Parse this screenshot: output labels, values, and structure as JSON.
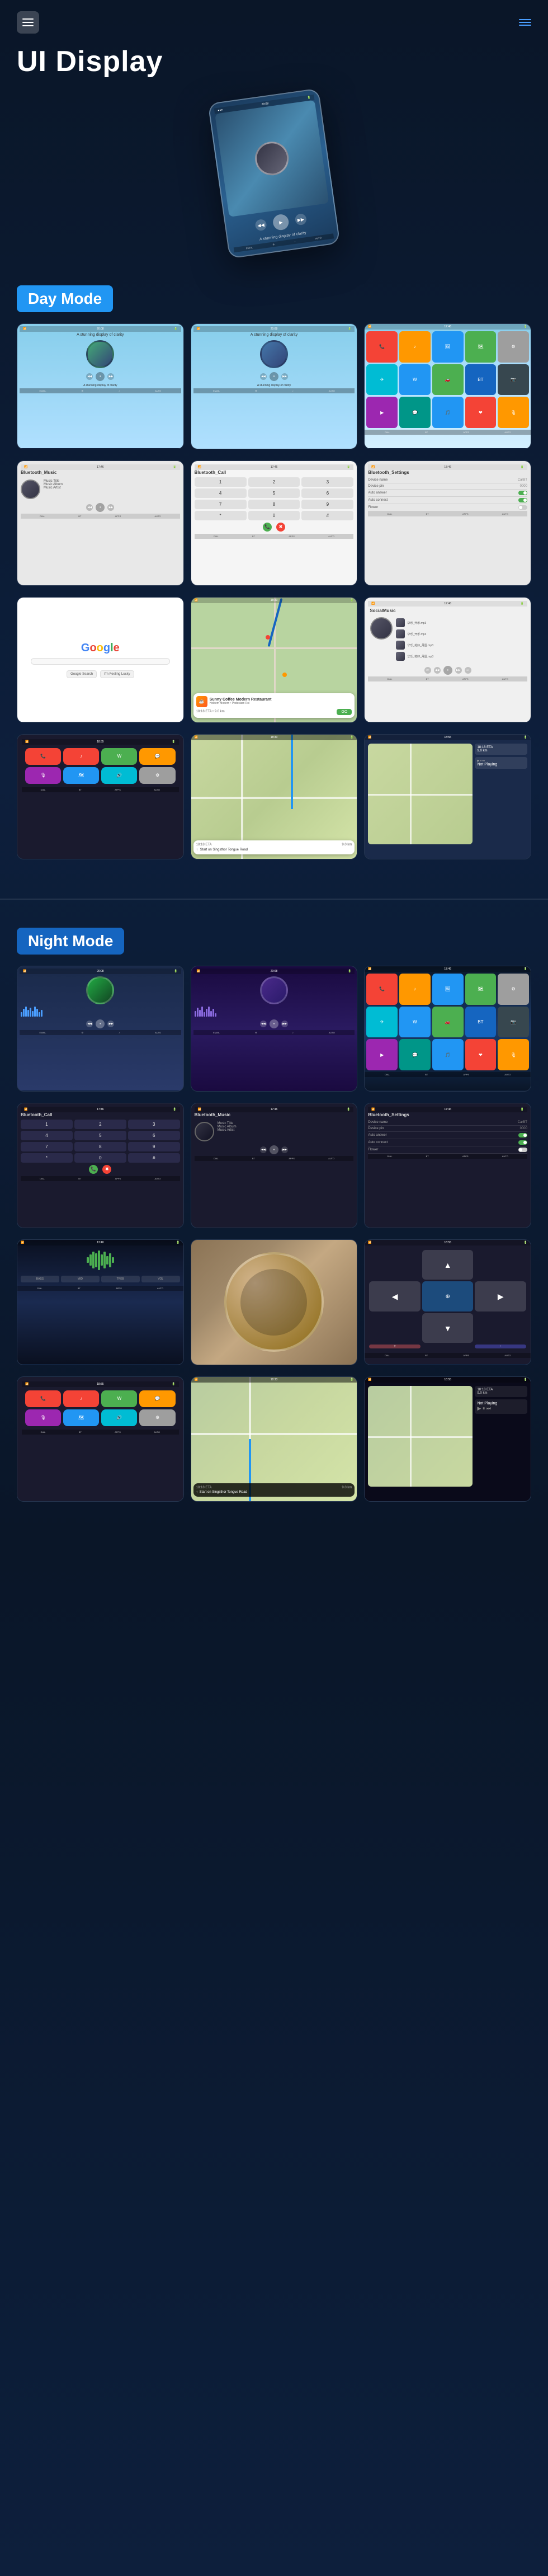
{
  "header": {
    "title": "UI Display",
    "menu_icon": "☰",
    "lines_icon": "≡"
  },
  "hero": {
    "time": "20:08",
    "subtitle": "A stunning display of clarity"
  },
  "day_mode": {
    "label": "Day Mode",
    "screens": [
      {
        "id": "day-home-1",
        "type": "home",
        "time": "20:08",
        "subtitle": "A stunning display of clarity"
      },
      {
        "id": "day-home-2",
        "type": "home",
        "time": "20:08",
        "subtitle": "A stunning display of clarity"
      },
      {
        "id": "day-apps",
        "type": "apps"
      },
      {
        "id": "day-bt-music",
        "type": "bluetooth_music",
        "title": "Bluetooth_Music"
      },
      {
        "id": "day-bt-call",
        "type": "bluetooth_call",
        "title": "Bluetooth_Call"
      },
      {
        "id": "day-bt-settings",
        "type": "bluetooth_settings",
        "title": "Bluetooth_Settings"
      },
      {
        "id": "day-google",
        "type": "google"
      },
      {
        "id": "day-map",
        "type": "map"
      },
      {
        "id": "day-social",
        "type": "social_music",
        "title": "SocialMusic"
      },
      {
        "id": "day-carplay1",
        "type": "carplay"
      },
      {
        "id": "day-nav1",
        "type": "navigation"
      },
      {
        "id": "day-carplay2",
        "type": "carplay2"
      }
    ]
  },
  "night_mode": {
    "label": "Night Mode",
    "screens": [
      {
        "id": "night-home-1",
        "type": "home_night",
        "time": "20:08"
      },
      {
        "id": "night-home-2",
        "type": "home_night2",
        "time": "20:08"
      },
      {
        "id": "night-apps",
        "type": "apps_night"
      },
      {
        "id": "night-bt-call",
        "type": "bluetooth_call_night",
        "title": "Bluetooth_Call"
      },
      {
        "id": "night-bt-music",
        "type": "bluetooth_music_night",
        "title": "Bluetooth_Music"
      },
      {
        "id": "night-bt-settings",
        "type": "bluetooth_settings_night",
        "title": "Bluetooth_Settings"
      },
      {
        "id": "night-landscape",
        "type": "landscape_night"
      },
      {
        "id": "night-bowl",
        "type": "bowl"
      },
      {
        "id": "night-nav-map",
        "type": "nav_map_night"
      },
      {
        "id": "night-carplay1",
        "type": "carplay_night"
      },
      {
        "id": "night-nav2",
        "type": "nav_night"
      },
      {
        "id": "night-carplay2",
        "type": "carplay2_night"
      }
    ]
  },
  "music": {
    "title": "Music Title",
    "album": "Music Album",
    "artist": "Music Artist"
  },
  "bluetooth": {
    "device_name_label": "Device name",
    "device_name_value": "CarBT",
    "device_pin_label": "Device pin",
    "device_pin_value": "0000",
    "auto_answer_label": "Auto answer",
    "auto_connect_label": "Auto connect",
    "flower_label": "Flower"
  },
  "coffee": {
    "name": "Sunny Coffee Modern Restaurant",
    "address": "Holdem Modern\nPodestam Rol",
    "eta": "18:18 ETA",
    "distance": "9.0 km",
    "go_label": "GO"
  },
  "navigation": {
    "eta": "18:18 ETA",
    "distance": "9.0 km",
    "instruction": "Start on Singsthor Tongue Road",
    "not_playing": "Not Playing"
  }
}
